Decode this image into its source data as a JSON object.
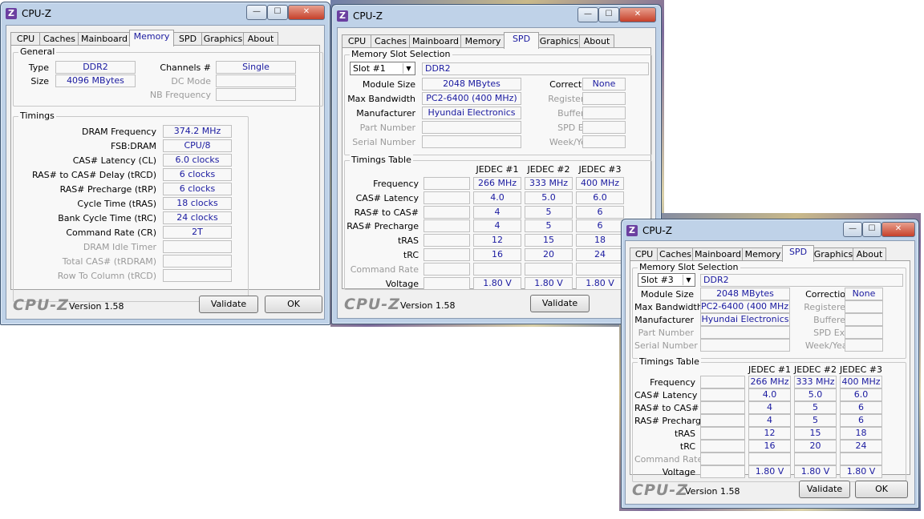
{
  "win1": {
    "title": "CPU-Z",
    "tabs": [
      "CPU",
      "Caches",
      "Mainboard",
      "Memory",
      "SPD",
      "Graphics",
      "About"
    ],
    "active_tab": "Memory",
    "general": {
      "label": "General",
      "type_label": "Type",
      "type_value": "DDR2",
      "size_label": "Size",
      "size_value": "4096 MBytes",
      "channels_label": "Channels #",
      "channels_value": "Single",
      "dc_mode_label": "DC Mode",
      "dc_mode_value": "",
      "nb_freq_label": "NB Frequency",
      "nb_freq_value": ""
    },
    "timings": {
      "label": "Timings",
      "rows": [
        {
          "label": "DRAM Frequency",
          "value": "374.2 MHz",
          "dim": false
        },
        {
          "label": "FSB:DRAM",
          "value": "CPU/8",
          "dim": false
        },
        {
          "label": "CAS# Latency (CL)",
          "value": "6.0 clocks",
          "dim": false
        },
        {
          "label": "RAS# to CAS# Delay (tRCD)",
          "value": "6 clocks",
          "dim": false
        },
        {
          "label": "RAS# Precharge (tRP)",
          "value": "6 clocks",
          "dim": false
        },
        {
          "label": "Cycle Time (tRAS)",
          "value": "18 clocks",
          "dim": false
        },
        {
          "label": "Bank Cycle Time (tRC)",
          "value": "24 clocks",
          "dim": false
        },
        {
          "label": "Command Rate (CR)",
          "value": "2T",
          "dim": false
        },
        {
          "label": "DRAM Idle Timer",
          "value": "",
          "dim": true
        },
        {
          "label": "Total CAS# (tRDRAM)",
          "value": "",
          "dim": true
        },
        {
          "label": "Row To Column (tRCD)",
          "value": "",
          "dim": true
        }
      ]
    },
    "footer": {
      "logo": "CPU-Z",
      "version": "Version 1.58",
      "validate": "Validate",
      "ok": "OK"
    }
  },
  "win2": {
    "title": "CPU-Z",
    "tabs": [
      "CPU",
      "Caches",
      "Mainboard",
      "Memory",
      "SPD",
      "Graphics",
      "About"
    ],
    "active_tab": "SPD",
    "slot_group_label": "Memory Slot Selection",
    "slot": "Slot #1",
    "mem_type": "DDR2",
    "module_size_label": "Module Size",
    "module_size": "2048 MBytes",
    "max_bw_label": "Max Bandwidth",
    "max_bw": "PC2-6400 (400 MHz)",
    "manufacturer_label": "Manufacturer",
    "manufacturer": "Hyundai Electronics",
    "part_label": "Part Number",
    "serial_label": "Serial Number",
    "correction_label": "Correction",
    "correction": "None",
    "registered_label": "Registered",
    "buffered_label": "Buffered",
    "spd_ext_label": "SPD Ext.",
    "week_year_label": "Week/Year",
    "timings_label": "Timings Table",
    "columns": [
      "JEDEC #1",
      "JEDEC #2",
      "JEDEC #3"
    ],
    "rows": [
      {
        "label": "Frequency",
        "values": [
          "266 MHz",
          "333 MHz",
          "400 MHz"
        ],
        "dim": false
      },
      {
        "label": "CAS# Latency",
        "values": [
          "4.0",
          "5.0",
          "6.0"
        ],
        "dim": false
      },
      {
        "label": "RAS# to CAS#",
        "values": [
          "4",
          "5",
          "6"
        ],
        "dim": false
      },
      {
        "label": "RAS# Precharge",
        "values": [
          "4",
          "5",
          "6"
        ],
        "dim": false
      },
      {
        "label": "tRAS",
        "values": [
          "12",
          "15",
          "18"
        ],
        "dim": false
      },
      {
        "label": "tRC",
        "values": [
          "16",
          "20",
          "24"
        ],
        "dim": false
      },
      {
        "label": "Command Rate",
        "values": [
          "",
          "",
          ""
        ],
        "dim": true
      },
      {
        "label": "Voltage",
        "values": [
          "1.80 V",
          "1.80 V",
          "1.80 V"
        ],
        "dim": false
      }
    ],
    "footer": {
      "logo": "CPU-Z",
      "version": "Version 1.58",
      "validate": "Validate"
    }
  },
  "win3": {
    "title": "CPU-Z",
    "tabs": [
      "CPU",
      "Caches",
      "Mainboard",
      "Memory",
      "SPD",
      "Graphics",
      "About"
    ],
    "active_tab": "SPD",
    "slot_group_label": "Memory Slot Selection",
    "slot": "Slot #3",
    "mem_type": "DDR2",
    "module_size_label": "Module Size",
    "module_size": "2048 MBytes",
    "max_bw_label": "Max Bandwidth",
    "max_bw": "PC2-6400 (400 MHz)",
    "manufacturer_label": "Manufacturer",
    "manufacturer": "Hyundai Electronics",
    "part_label": "Part Number",
    "serial_label": "Serial Number",
    "correction_label": "Correction",
    "correction": "None",
    "registered_label": "Registered",
    "buffered_label": "Buffered",
    "spd_ext_label": "SPD Ext.",
    "week_year_label": "Week/Year",
    "timings_label": "Timings Table",
    "columns": [
      "JEDEC #1",
      "JEDEC #2",
      "JEDEC #3"
    ],
    "rows": [
      {
        "label": "Frequency",
        "values": [
          "266 MHz",
          "333 MHz",
          "400 MHz"
        ],
        "dim": false
      },
      {
        "label": "CAS# Latency",
        "values": [
          "4.0",
          "5.0",
          "6.0"
        ],
        "dim": false
      },
      {
        "label": "RAS# to CAS#",
        "values": [
          "4",
          "5",
          "6"
        ],
        "dim": false
      },
      {
        "label": "RAS# Precharge",
        "values": [
          "4",
          "5",
          "6"
        ],
        "dim": false
      },
      {
        "label": "tRAS",
        "values": [
          "12",
          "15",
          "18"
        ],
        "dim": false
      },
      {
        "label": "tRC",
        "values": [
          "16",
          "20",
          "24"
        ],
        "dim": false
      },
      {
        "label": "Command Rate",
        "values": [
          "",
          "",
          ""
        ],
        "dim": true
      },
      {
        "label": "Voltage",
        "values": [
          "1.80 V",
          "1.80 V",
          "1.80 V"
        ],
        "dim": false
      }
    ],
    "footer": {
      "logo": "CPU-Z",
      "version": "Version 1.58",
      "validate": "Validate",
      "ok": "OK"
    }
  },
  "icons": {
    "minimize": "minimize-icon",
    "maximize": "maximize-icon",
    "close": "close-icon",
    "app": "cpuz-app-icon",
    "dropdown": "chevron-down-icon"
  }
}
